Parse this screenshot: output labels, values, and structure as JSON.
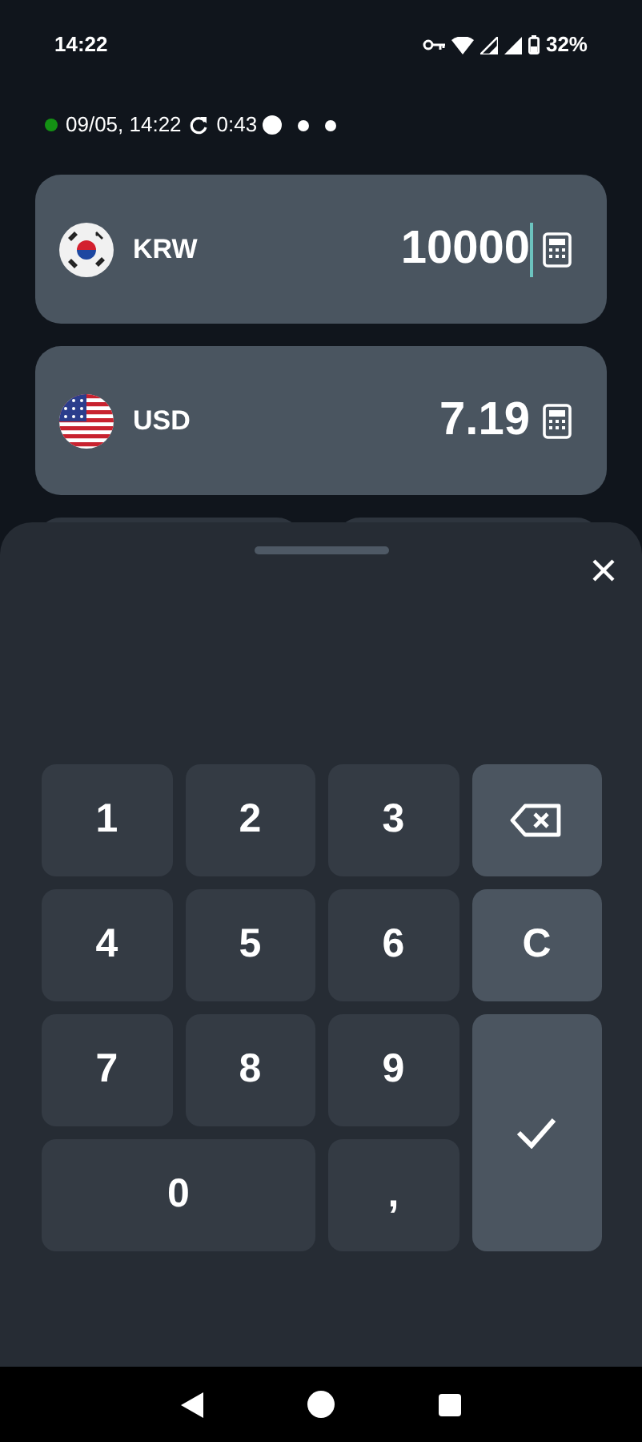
{
  "status_bar": {
    "time": "14:22",
    "battery": "32%"
  },
  "info": {
    "updated": "09/05, 14:22",
    "countdown": "0:43",
    "pages": [
      {
        "selected": true
      },
      {
        "selected": false
      },
      {
        "selected": false
      }
    ]
  },
  "currencies": [
    {
      "kind": "korea",
      "code": "KRW",
      "amount": "10000",
      "focused": true
    },
    {
      "kind": "usa",
      "code": "USD",
      "amount": "7.19",
      "focused": false
    }
  ],
  "keypad": [
    {
      "kind": "digit",
      "label": "1"
    },
    {
      "kind": "digit",
      "label": "2"
    },
    {
      "kind": "digit",
      "label": "3"
    },
    {
      "kind": "backspace"
    },
    {
      "kind": "digit",
      "label": "4"
    },
    {
      "kind": "digit",
      "label": "5"
    },
    {
      "kind": "digit",
      "label": "6"
    },
    {
      "kind": "clear",
      "label": "C"
    },
    {
      "kind": "digit",
      "label": "7"
    },
    {
      "kind": "digit",
      "label": "8"
    },
    {
      "kind": "digit",
      "label": "9"
    },
    {
      "kind": "confirm"
    },
    {
      "kind": "wide",
      "label": "0"
    },
    {
      "kind": "digit",
      "label": ","
    }
  ]
}
